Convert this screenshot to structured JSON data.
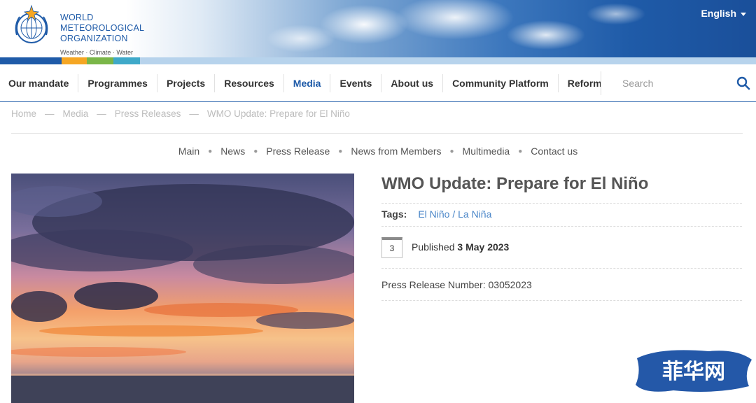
{
  "header": {
    "org_name_lines": [
      "WORLD",
      "METEOROLOGICAL",
      "ORGANIZATION"
    ],
    "tagline": "Weather · Climate · Water",
    "language": "English",
    "stripe_colors": [
      "#1f5ba8",
      "#f5a623",
      "#7ab648",
      "#3fa9c9",
      "#b7d3ec"
    ]
  },
  "nav": {
    "items": [
      {
        "label": "Our mandate"
      },
      {
        "label": "Programmes"
      },
      {
        "label": "Projects"
      },
      {
        "label": "Resources"
      },
      {
        "label": "Media",
        "active": true
      },
      {
        "label": "Events"
      },
      {
        "label": "About us"
      },
      {
        "label": "Community Platform"
      },
      {
        "label": "Reform"
      }
    ],
    "search_placeholder": "Search",
    "accent_color": "#1f5ba8"
  },
  "breadcrumb": [
    "Home",
    "Media",
    "Press Releases",
    "WMO Update: Prepare for El Niño"
  ],
  "breadcrumb_separator": "—",
  "subnav": [
    "Main",
    "News",
    "Press Release",
    "News from Members",
    "Multimedia",
    "Contact us"
  ],
  "article": {
    "title": "WMO Update: Prepare for El Niño",
    "tags_label": "Tags:",
    "tag": "El Niño / La Niña",
    "calendar_day": "3",
    "published_label": "Published",
    "published_date": "3 May 2023",
    "press_release_number": "Press Release Number: 03052023",
    "image_subject": "sunset sky with clouds over the sea"
  },
  "watermark": {
    "text": "菲华网"
  }
}
